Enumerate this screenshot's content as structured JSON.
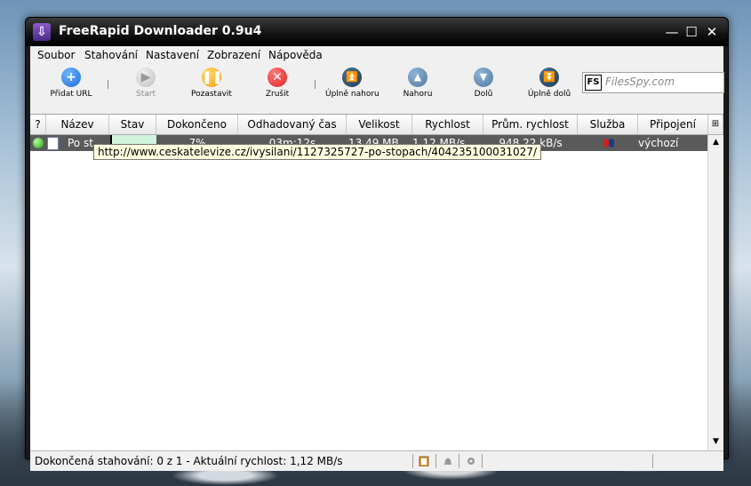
{
  "window": {
    "title": "FreeRapid Downloader 0.9u4",
    "controls": {
      "minimize": "—",
      "maximize": "☐",
      "close": "✕"
    }
  },
  "menu": [
    {
      "label": "Soubor"
    },
    {
      "label": "Stahování"
    },
    {
      "label": "Nastavení"
    },
    {
      "label": "Zobrazení"
    },
    {
      "label": "Nápověda"
    }
  ],
  "toolbar": {
    "add_url": "Přidat URL",
    "start": "Start",
    "pause": "Pozastavit",
    "cancel": "Zrušit",
    "top": "Úplně nahoru",
    "up": "Nahoru",
    "down": "Dolů",
    "bottom": "Úplně dolů",
    "filesspy_logo": "FS",
    "filesspy_text": "FilesSpy.com"
  },
  "table": {
    "columns": [
      "?",
      "Název",
      "Stav",
      "Dokončeno",
      "Odhadovaný čas",
      "Velikost",
      "Rychlost",
      "Prům. rychlost",
      "Služba",
      "Připojení"
    ],
    "rows": [
      {
        "name": "Po st...",
        "status": "",
        "completed": "7%",
        "progress": 0.07,
        "eta": "03m:12s",
        "size": "13,49 MB ...",
        "speed": "1,12 MB/s",
        "avg_speed": "948,22 kB/s",
        "connection": "výchozí"
      }
    ],
    "tooltip": "http://www.ceskatelevize.cz/ivysilani/1127325727-po-stopach/404235100031027/"
  },
  "status": {
    "text": "Dokončená stahování: 0 z 1 - Aktuální rychlost: 1,12 MB/s"
  },
  "colors": {
    "selected_row": "#5a5a5a",
    "progress_fill": "#cff3dd",
    "add_blue": "#1e6ed8",
    "pause_orange": "#f2a20c",
    "cancel_red": "#e02020",
    "nav_dark": "#1d3b5a",
    "nav_light": "#4d7aa0"
  }
}
